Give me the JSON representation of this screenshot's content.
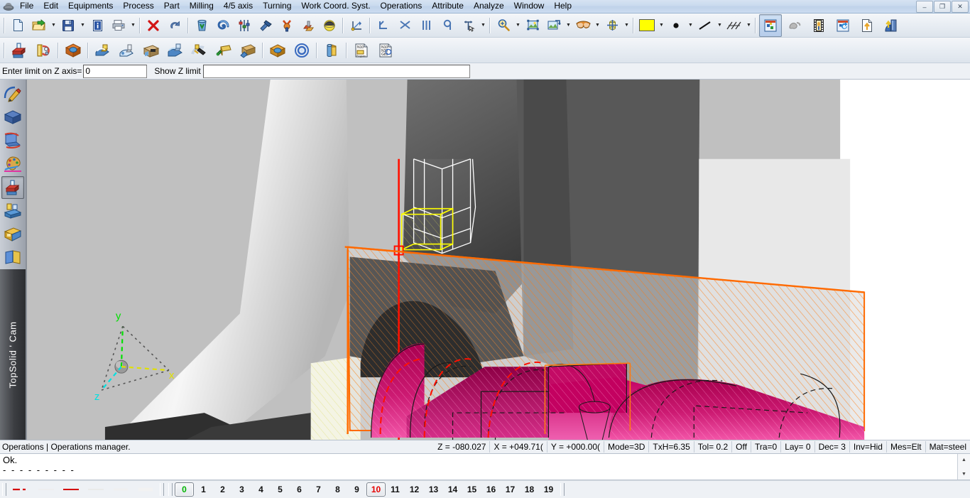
{
  "window": {
    "logo_icon": "topsolid-logo-icon",
    "controls": [
      {
        "name": "minimize-button",
        "glyph": "–"
      },
      {
        "name": "restore-button",
        "glyph": "❐"
      },
      {
        "name": "close-button",
        "glyph": "✕"
      }
    ]
  },
  "menu": {
    "items": [
      {
        "label": "File"
      },
      {
        "label": "Edit"
      },
      {
        "label": "Equipments"
      },
      {
        "label": "Process"
      },
      {
        "label": "Part"
      },
      {
        "label": "Milling"
      },
      {
        "label": "4/5 axis"
      },
      {
        "label": "Turning"
      },
      {
        "label": "Work Coord. Syst."
      },
      {
        "label": "Operations"
      },
      {
        "label": "Attribute"
      },
      {
        "label": "Analyze"
      },
      {
        "label": "Window"
      },
      {
        "label": "Help"
      }
    ]
  },
  "toolbar_main": {
    "buttons": [
      {
        "name": "new-document-icon"
      },
      {
        "name": "open-folder-icon"
      },
      {
        "name": "open-dropdown-arrow"
      },
      {
        "name": "save-icon"
      },
      {
        "name": "save-dropdown-arrow"
      },
      {
        "name": "document-info-icon"
      },
      {
        "name": "print-icon"
      },
      {
        "name": "print-dropdown-arrow"
      },
      {
        "name": "delete-icon"
      },
      {
        "name": "undo-icon"
      },
      {
        "name": "trash-recycle-icon"
      },
      {
        "name": "blue-swirl-icon"
      },
      {
        "name": "parameters-sliders-icon"
      },
      {
        "name": "hammer-tool-icon"
      },
      {
        "name": "clamp-tool-icon"
      },
      {
        "name": "fixture-icon"
      },
      {
        "name": "simulation-globe-icon"
      },
      {
        "name": "coordinate-system-icon"
      },
      {
        "name": "point-snap-icon"
      },
      {
        "name": "intersection-snap-icon"
      },
      {
        "name": "midpoint-snap-icon"
      },
      {
        "name": "tangent-snap-icon"
      },
      {
        "name": "element-pick-icon"
      },
      {
        "name": "element-pick-dropdown-arrow"
      },
      {
        "name": "zoom-icon"
      },
      {
        "name": "zoom-dropdown-arrow"
      },
      {
        "name": "fit-view-icon"
      },
      {
        "name": "view-image-icon"
      },
      {
        "name": "view-image-dropdown-arrow"
      },
      {
        "name": "shading-glasses-icon"
      },
      {
        "name": "shading-dropdown-arrow"
      },
      {
        "name": "render-mode-icon"
      },
      {
        "name": "render-mode-dropdown-arrow"
      },
      {
        "name": "color-swatch-icon"
      },
      {
        "name": "color-dropdown-arrow"
      },
      {
        "name": "point-style-icon"
      },
      {
        "name": "point-style-dropdown-arrow"
      },
      {
        "name": "line-style-icon"
      },
      {
        "name": "line-style-dropdown-arrow"
      },
      {
        "name": "hatch-style-icon"
      },
      {
        "name": "hatch-style-dropdown-arrow"
      },
      {
        "name": "show-all-icon"
      },
      {
        "name": "hide-elements-icon"
      },
      {
        "name": "filmstrip-icon"
      },
      {
        "name": "refresh-view-icon"
      },
      {
        "name": "export-up-icon"
      },
      {
        "name": "import-icon"
      }
    ],
    "color_swatch": "#ffff00"
  },
  "toolbar_cam": {
    "buttons": [
      {
        "name": "machine-setup-icon"
      },
      {
        "name": "tool-magazine-icon"
      },
      {
        "name": "stock-icon"
      },
      {
        "name": "contouring-operation-icon"
      },
      {
        "name": "drilling-operation-icon"
      },
      {
        "name": "pocketing-operation-icon"
      },
      {
        "name": "facing-operation-icon"
      },
      {
        "name": "curve-machining-icon"
      },
      {
        "name": "surface-machining-icon"
      },
      {
        "name": "roughing-operation-icon"
      },
      {
        "name": "turning-operation-icon"
      },
      {
        "name": "circular-operation-icon"
      },
      {
        "name": "toolpath-verify-icon"
      },
      {
        "name": "nc-program-icon"
      },
      {
        "name": "nc-code-g89-icon"
      }
    ]
  },
  "prompt": {
    "label": "Enter limit on Z axis=",
    "value": "0",
    "button_label": "Show Z limit",
    "secondary_value": ""
  },
  "sidebar": {
    "brand": "TopSolid ' Cam",
    "buttons": [
      {
        "name": "sketch-pencil-icon",
        "pressed": false
      },
      {
        "name": "solid-box-icon",
        "pressed": false
      },
      {
        "name": "sheet-metal-icon",
        "pressed": false
      },
      {
        "name": "attribute-palette-icon",
        "pressed": false
      },
      {
        "name": "machining-setup-icon",
        "pressed": true
      },
      {
        "name": "machining-stock-icon",
        "pressed": false
      },
      {
        "name": "machining-operations-icon",
        "pressed": false
      },
      {
        "name": "documents-icon",
        "pressed": false
      },
      {
        "name": "simulation-icon",
        "pressed": false
      }
    ]
  },
  "viewport": {
    "axis_labels": {
      "x": "x",
      "y": "y",
      "z": "z"
    },
    "background_color": "#c0c0c0",
    "part_color": "#c2005f",
    "toolpath_color": "#ff2000",
    "limit_plane_color": "#ff6600",
    "tool_wireframe_color": "#ffffff",
    "highlight_color": "#ffff00"
  },
  "statusbar": {
    "context": "Operations | Operations manager.",
    "cells": [
      {
        "name": "status-z",
        "text": "Z = -080.027"
      },
      {
        "name": "status-x",
        "text": "X = +049.71("
      },
      {
        "name": "status-y",
        "text": "Y = +000.00("
      },
      {
        "name": "status-mode",
        "text": "Mode=3D"
      },
      {
        "name": "status-txh",
        "text": "TxH=6.35"
      },
      {
        "name": "status-tol",
        "text": "Tol=  0.2"
      },
      {
        "name": "status-off",
        "text": "Off"
      },
      {
        "name": "status-tra",
        "text": "Tra=0"
      },
      {
        "name": "status-lay",
        "text": "Lay=  0"
      },
      {
        "name": "status-dec",
        "text": "Dec= 3"
      },
      {
        "name": "status-inv",
        "text": "Inv=Hid"
      },
      {
        "name": "status-mes",
        "text": "Mes=Elt"
      },
      {
        "name": "status-mat",
        "text": "Mat=steel"
      }
    ]
  },
  "message": {
    "line1": "Ok.",
    "line2": "- - - - - - - - -"
  },
  "bottombar": {
    "line_styles": [
      {
        "name": "linestyle-dashdot",
        "color": "#d40000",
        "pattern": "dashdot"
      },
      {
        "name": "linestyle-thin-white",
        "color": "#ededed",
        "pattern": "solid"
      },
      {
        "name": "linestyle-solid-red",
        "color": "#d40000",
        "pattern": "solid"
      },
      {
        "name": "linestyle-thin-light",
        "color": "#e8e8e8",
        "pattern": "solid"
      },
      {
        "name": "linestyle-medium",
        "color": "#f0f0f0",
        "pattern": "solid"
      },
      {
        "name": "linestyle-thick",
        "color": "#f2f2f2",
        "pattern": "solid"
      }
    ],
    "layers": [
      {
        "label": "0",
        "state": "green"
      },
      {
        "label": "1",
        "state": "normal"
      },
      {
        "label": "2",
        "state": "normal"
      },
      {
        "label": "3",
        "state": "normal"
      },
      {
        "label": "4",
        "state": "normal"
      },
      {
        "label": "5",
        "state": "normal"
      },
      {
        "label": "6",
        "state": "normal"
      },
      {
        "label": "7",
        "state": "normal"
      },
      {
        "label": "8",
        "state": "normal"
      },
      {
        "label": "9",
        "state": "normal"
      },
      {
        "label": "10",
        "state": "red"
      },
      {
        "label": "11",
        "state": "normal"
      },
      {
        "label": "12",
        "state": "normal"
      },
      {
        "label": "13",
        "state": "normal"
      },
      {
        "label": "14",
        "state": "normal"
      },
      {
        "label": "15",
        "state": "normal"
      },
      {
        "label": "16",
        "state": "normal"
      },
      {
        "label": "17",
        "state": "normal"
      },
      {
        "label": "18",
        "state": "normal"
      },
      {
        "label": "19",
        "state": "normal"
      }
    ]
  }
}
